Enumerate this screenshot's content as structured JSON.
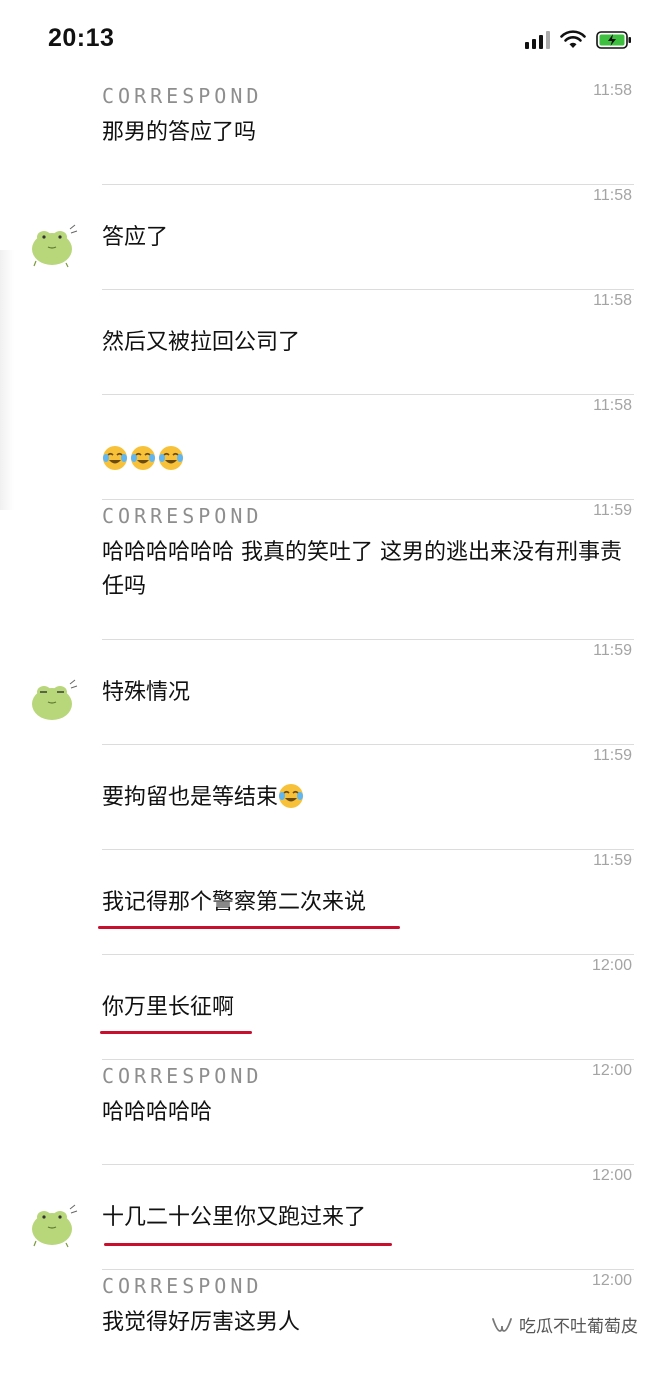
{
  "status_bar": {
    "time": "20:13",
    "icons": [
      "cellular-signal-icon",
      "wifi-icon",
      "battery-charging-icon"
    ],
    "battery_color": "#3fbf3f"
  },
  "colors": {
    "underline": "#c8102e",
    "separator": "#dcdcdc",
    "timestamp": "#a4a4a4",
    "sender": "#8e8e8e",
    "avatar_green": "#b8d67a"
  },
  "messages": [
    {
      "sender": "CORRESPOND",
      "time": "11:58",
      "text": "那男的答应了吗"
    },
    {
      "sender": "",
      "time": "11:58",
      "text": "答应了",
      "avatar": "frog-avatar-icon"
    },
    {
      "sender": "",
      "time": "11:58",
      "text": "然后又被拉回公司了"
    },
    {
      "sender": "",
      "time": "11:58",
      "text": "",
      "emoji": [
        "laughing-crying-emoji",
        "laughing-crying-emoji",
        "laughing-crying-emoji"
      ]
    },
    {
      "sender": "CORRESPOND",
      "time": "11:59",
      "text": "哈哈哈哈哈哈 我真的笑吐了 这男的逃出来没有刑事责任吗"
    },
    {
      "sender": "",
      "time": "11:59",
      "text": "特殊情况",
      "avatar": "frog-avatar-icon"
    },
    {
      "sender": "",
      "time": "11:59",
      "text": "要拘留也是等结束",
      "emoji": [
        "laughing-crying-emoji"
      ]
    },
    {
      "sender": "",
      "time": "11:59",
      "text": "我记得那个警察第二次来说",
      "underlined": true
    },
    {
      "sender": "",
      "time": "12:00",
      "text": "你万里长征啊",
      "underlined": true
    },
    {
      "sender": "CORRESPOND",
      "time": "12:00",
      "text": "哈哈哈哈哈"
    },
    {
      "sender": "",
      "time": "12:00",
      "text": "十几二十公里你又跑过来了",
      "avatar": "frog-avatar-icon",
      "underlined": true
    },
    {
      "sender": "CORRESPOND",
      "time": "12:00",
      "text": "我觉得好厉害这男人"
    }
  ],
  "watermark": {
    "text": "吃瓜不吐葡萄皮",
    "icon": "wechat-channel-icon"
  }
}
